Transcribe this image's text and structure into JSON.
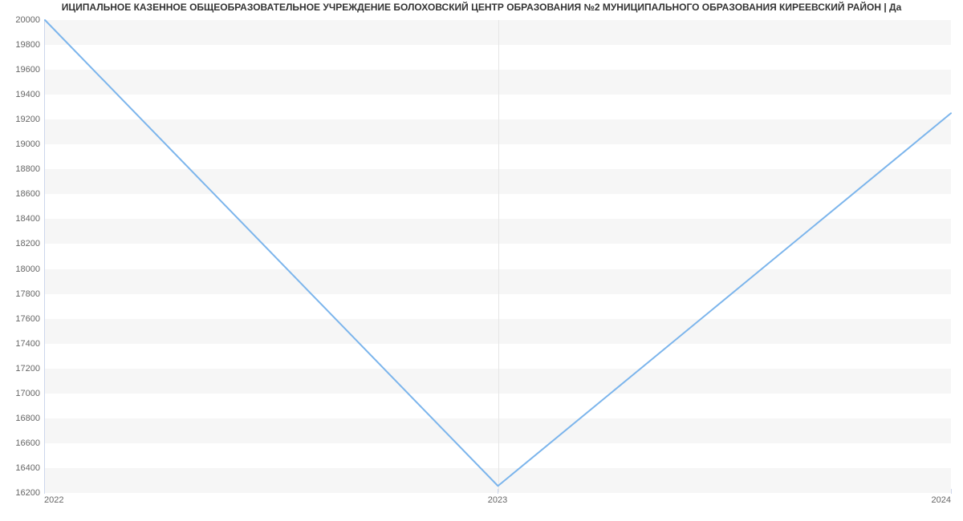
{
  "title": "ИЦИПАЛЬНОЕ КАЗЕННОЕ ОБЩЕОБРАЗОВАТЕЛЬНОЕ УЧРЕЖДЕНИЕ БОЛОХОВСКИЙ ЦЕНТР ОБРАЗОВАНИЯ №2 МУНИЦИПАЛЬНОГО ОБРАЗОВАНИЯ КИРЕЕВСКИЙ РАЙОН | Да",
  "chart_data": {
    "type": "line",
    "categories": [
      "2022",
      "2023",
      "2024"
    ],
    "values": [
      20000,
      16250,
      19250
    ],
    "title": "ИЦИПАЛЬНОЕ КАЗЕННОЕ ОБЩЕОБРАЗОВАТЕЛЬНОЕ УЧРЕЖДЕНИЕ БОЛОХОВСКИЙ ЦЕНТР ОБРАЗОВАНИЯ №2 МУНИЦИПАЛЬНОГО ОБРАЗОВАНИЯ КИРЕЕВСКИЙ РАЙОН | Да",
    "xlabel": "",
    "ylabel": "",
    "ylim": [
      16200,
      20000
    ],
    "y_ticks": [
      16200,
      16400,
      16600,
      16800,
      17000,
      17200,
      17400,
      17600,
      17800,
      18000,
      18200,
      18400,
      18600,
      18800,
      19000,
      19200,
      19400,
      19600,
      19800,
      20000
    ],
    "line_color": "#7cb5ec"
  }
}
